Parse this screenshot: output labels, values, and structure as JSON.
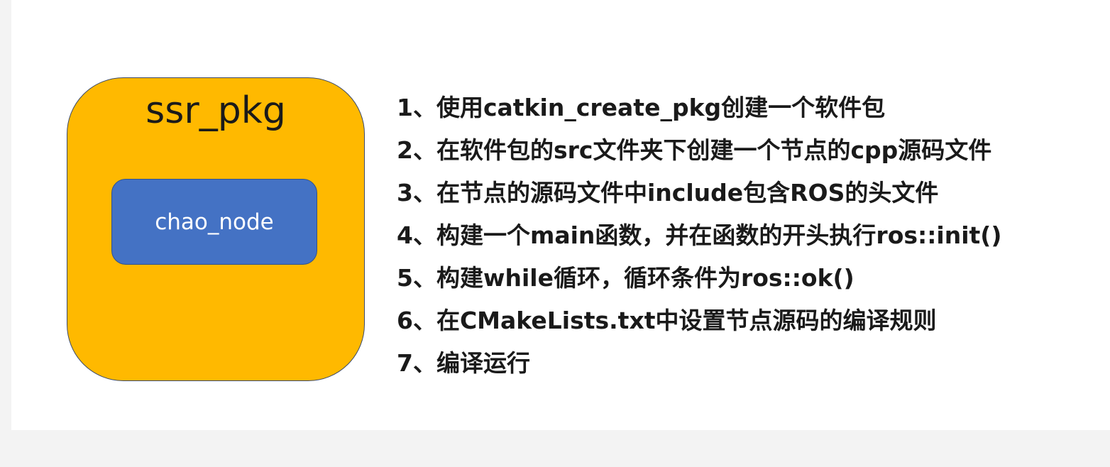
{
  "package": {
    "title": "ssr_pkg",
    "node_label": "chao_node"
  },
  "steps": [
    "1、使用catkin_create_pkg创建一个软件包",
    "2、在软件包的src文件夹下创建一个节点的cpp源码文件",
    "3、在节点的源码文件中include包含ROS的头文件",
    "4、构建一个main函数，并在函数的开头执行ros::init()",
    "5、构建while循环，循环条件为ros::ok()",
    "6、在CMakeLists.txt中设置节点源码的编译规则",
    "7、编译运行"
  ],
  "colors": {
    "package_fill": "#ffb900",
    "node_fill": "#4472c4",
    "text": "#1a1a1a"
  }
}
